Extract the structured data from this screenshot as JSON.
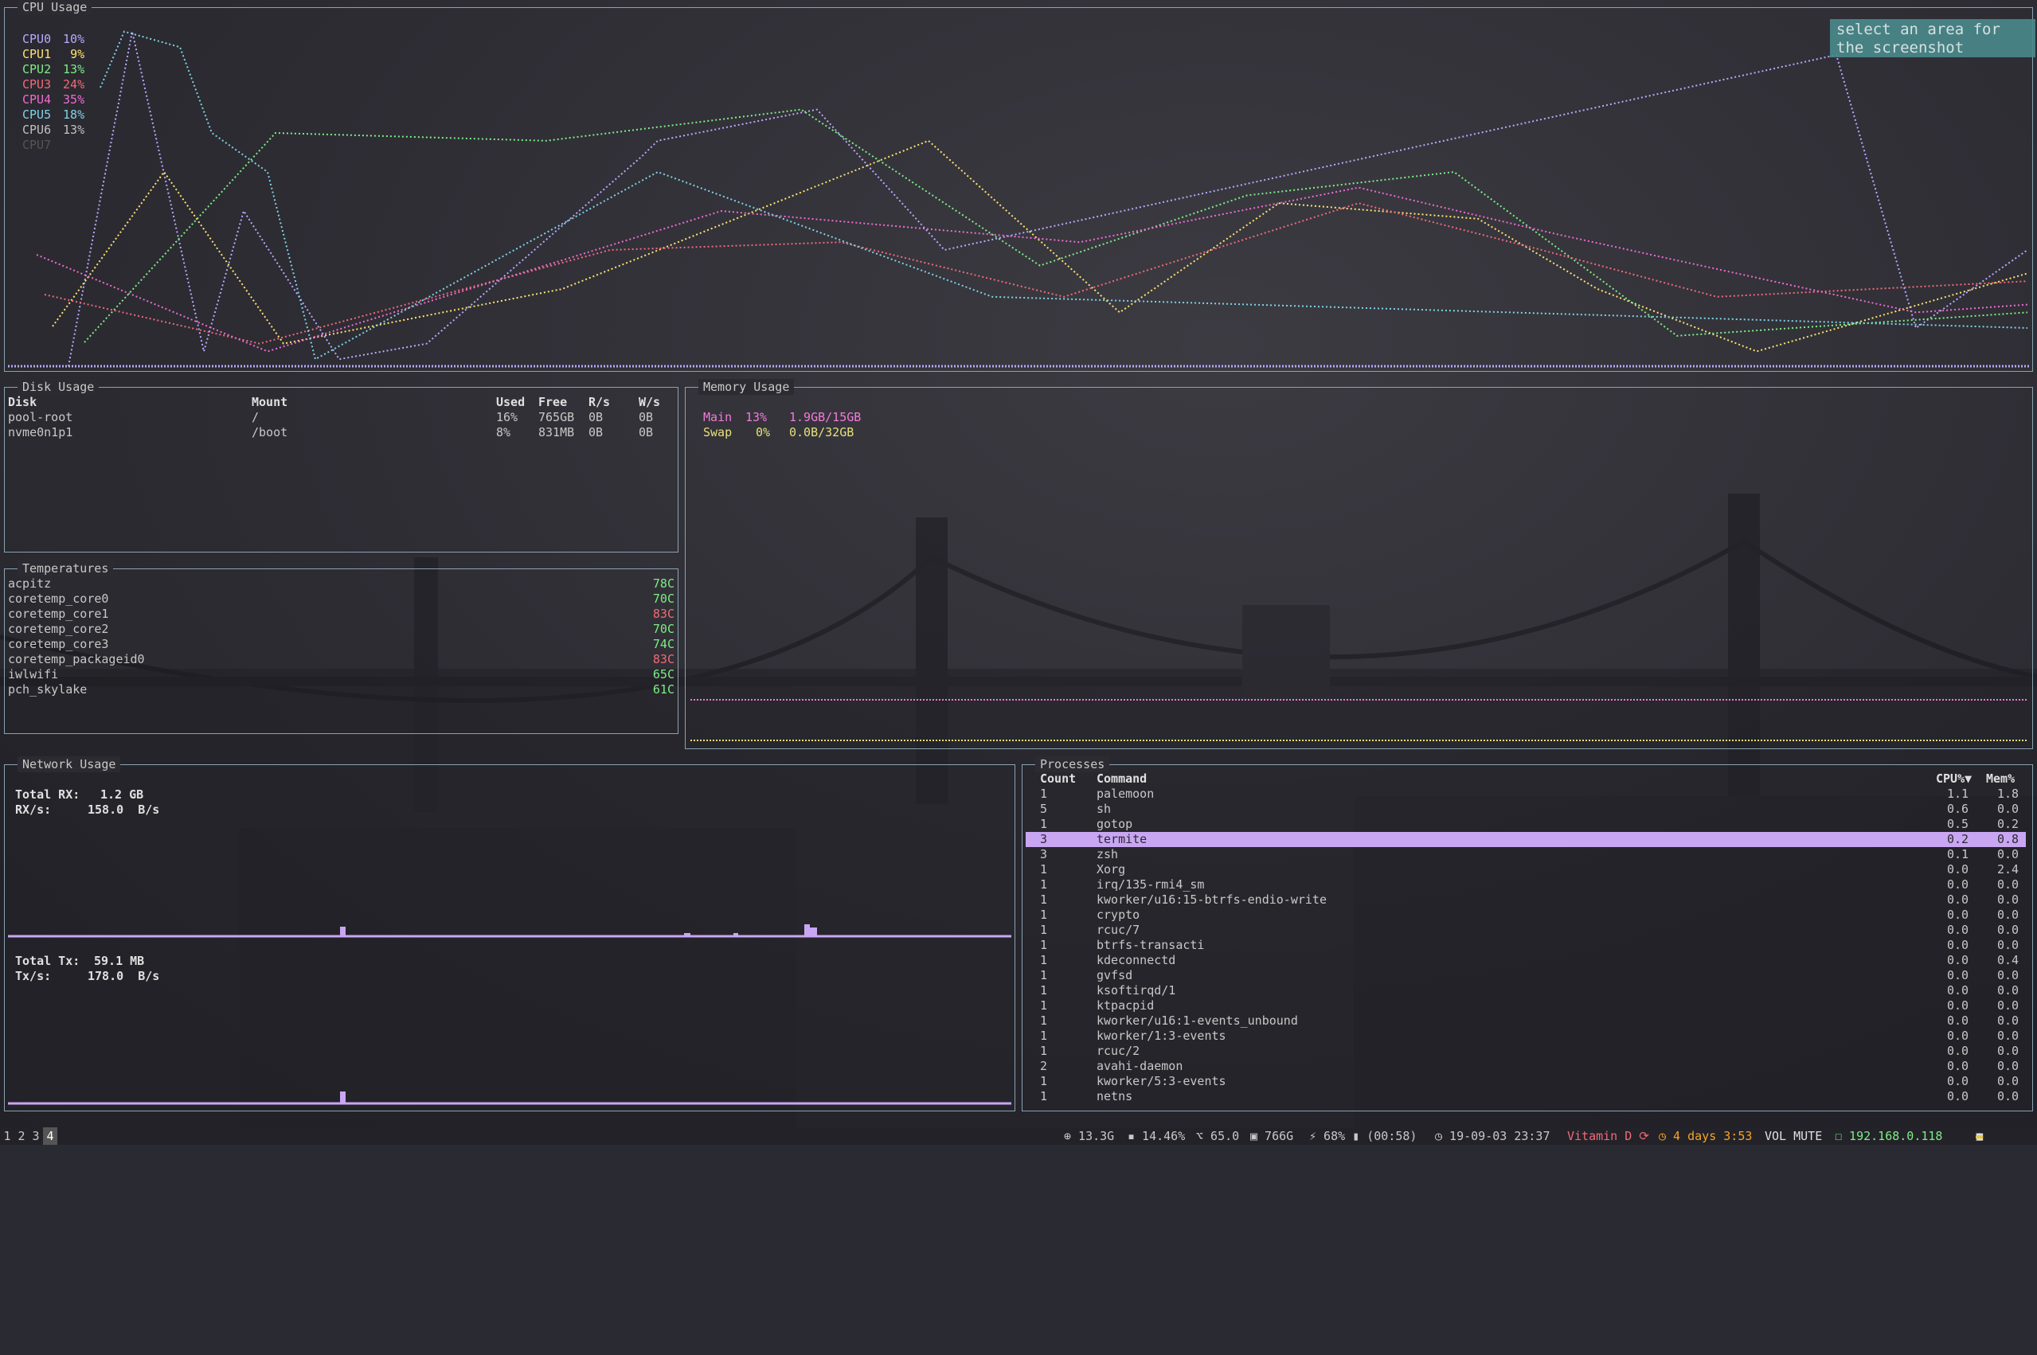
{
  "cpu": {
    "title": "CPU Usage",
    "cores": [
      {
        "label": "CPU0",
        "value": "10%",
        "color": "#b8a9ff"
      },
      {
        "label": "CPU1",
        "value": "9%",
        "color": "#ffe36e"
      },
      {
        "label": "CPU2",
        "value": "13%",
        "color": "#7dee84"
      },
      {
        "label": "CPU3",
        "value": "24%",
        "color": "#f26a78"
      },
      {
        "label": "CPU4",
        "value": "35%",
        "color": "#f06bd2"
      },
      {
        "label": "CPU5",
        "value": "18%",
        "color": "#7fd3e8"
      },
      {
        "label": "CPU6",
        "value": "13%",
        "color": "#c0c0c0"
      },
      {
        "label": "CPU7",
        "value": "",
        "color": "#555555"
      }
    ]
  },
  "screenshot_hint": "select an area for the screenshot",
  "disk": {
    "title": "Disk Usage",
    "headers": [
      "Disk",
      "Mount",
      "Used",
      "Free",
      "R/s",
      "W/s"
    ],
    "rows": [
      [
        "pool-root",
        "/",
        "16%",
        "765GB",
        "0B",
        "0B"
      ],
      [
        "nvme0n1p1",
        "/boot",
        "8%",
        "831MB",
        "0B",
        "0B"
      ]
    ]
  },
  "memory": {
    "title": "Memory Usage",
    "main_label": "Main",
    "main_pct": "13%",
    "main_val": "1.9GB/15GB",
    "main_color": "#f27ad8",
    "swap_label": "Swap",
    "swap_pct": "0%",
    "swap_val": "0.0B/32GB",
    "swap_color": "#e6e07a"
  },
  "temps": {
    "title": "Temperatures",
    "rows": [
      {
        "name": "acpitz",
        "val": "78C",
        "color": "#7dee84"
      },
      {
        "name": "coretemp_core0",
        "val": "70C",
        "color": "#7dee84"
      },
      {
        "name": "coretemp_core1",
        "val": "83C",
        "color": "#f26a78"
      },
      {
        "name": "coretemp_core2",
        "val": "70C",
        "color": "#7dee84"
      },
      {
        "name": "coretemp_core3",
        "val": "74C",
        "color": "#7dee84"
      },
      {
        "name": "coretemp_packageid0",
        "val": "83C",
        "color": "#f26a78"
      },
      {
        "name": "iwlwifi",
        "val": "65C",
        "color": "#7dee84"
      },
      {
        "name": "pch_skylake",
        "val": "61C",
        "color": "#7dee84"
      }
    ]
  },
  "network": {
    "title": "Network Usage",
    "rx_total_label": "Total RX:",
    "rx_total": "1.2 GB",
    "rx_rate_label": "RX/s:",
    "rx_rate": "158.0  B/s",
    "tx_total_label": "Total Tx:",
    "tx_total": "59.1 MB",
    "tx_rate_label": "Tx/s:",
    "tx_rate": "178.0  B/s"
  },
  "processes": {
    "title": "Processes",
    "headers": [
      "Count",
      "Command",
      "CPU%▼",
      "Mem%"
    ],
    "selected_index": 3,
    "rows": [
      [
        "1",
        "palemoon",
        "1.1",
        "1.8"
      ],
      [
        "5",
        "sh",
        "0.6",
        "0.0"
      ],
      [
        "1",
        "gotop",
        "0.5",
        "0.2"
      ],
      [
        "3",
        "termite",
        "0.2",
        "0.8"
      ],
      [
        "3",
        "zsh",
        "0.1",
        "0.0"
      ],
      [
        "1",
        "Xorg",
        "0.0",
        "2.4"
      ],
      [
        "1",
        "irq/135-rmi4_sm",
        "0.0",
        "0.0"
      ],
      [
        "1",
        "kworker/u16:15-btrfs-endio-write",
        "0.0",
        "0.0"
      ],
      [
        "1",
        "crypto",
        "0.0",
        "0.0"
      ],
      [
        "1",
        "rcuc/7",
        "0.0",
        "0.0"
      ],
      [
        "1",
        "btrfs-transacti",
        "0.0",
        "0.0"
      ],
      [
        "1",
        "kdeconnectd",
        "0.0",
        "0.4"
      ],
      [
        "1",
        "gvfsd",
        "0.0",
        "0.0"
      ],
      [
        "1",
        "ksoftirqd/1",
        "0.0",
        "0.0"
      ],
      [
        "1",
        "ktpacpid",
        "0.0",
        "0.0"
      ],
      [
        "1",
        "kworker/u16:1-events_unbound",
        "0.0",
        "0.0"
      ],
      [
        "1",
        "kworker/1:3-events",
        "0.0",
        "0.0"
      ],
      [
        "1",
        "rcuc/2",
        "0.0",
        "0.0"
      ],
      [
        "2",
        "avahi-daemon",
        "0.0",
        "0.0"
      ],
      [
        "1",
        "kworker/5:3-events",
        "0.0",
        "0.0"
      ],
      [
        "1",
        "netns",
        "0.0",
        "0.0"
      ]
    ]
  },
  "statusbar": {
    "workspaces": [
      "1",
      "2",
      "3",
      "4"
    ],
    "active_workspace": "4",
    "items": {
      "disk_io": "⊕ 13.3G",
      "cpu": "▪ 14.46%",
      "temp": "⌥ 65.0",
      "disk": "▣ 766G",
      "battery": "⚡ 68% ▮ (00:58)",
      "date": "◷ 19-09-03 23:37",
      "media": "Vitamin D ⟳",
      "uptime": "◷ 4 days 3:53",
      "volume": "VOL MUTE",
      "ip": "☐ 192.168.0.118"
    }
  }
}
